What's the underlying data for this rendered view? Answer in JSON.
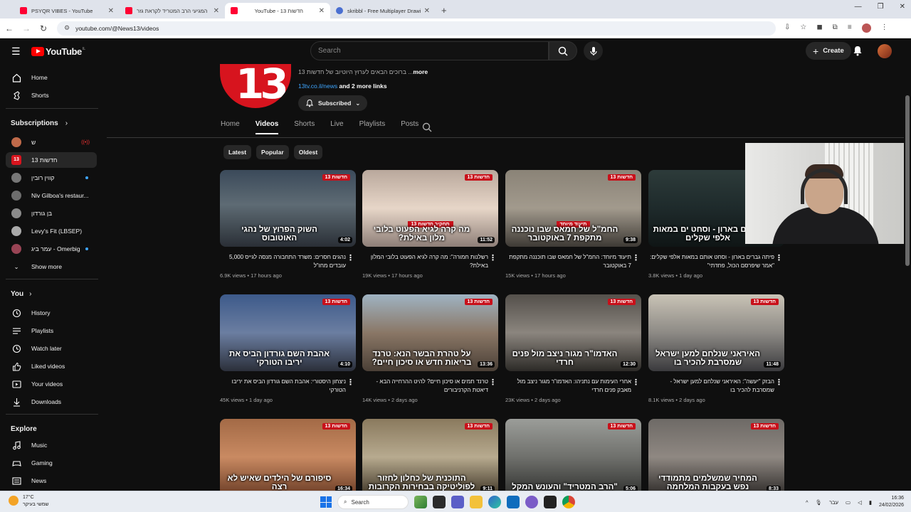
{
  "browser": {
    "tabs": [
      {
        "title": "PSYQR VIBES - YouTube",
        "icon": "youtube"
      },
      {
        "title": "המגיעי הרב המטריד לקראת גזר",
        "icon": "youtube"
      },
      {
        "title": "YouTube - חדשות 13",
        "icon": "youtube"
      },
      {
        "title": "skribbl - Free Multiplayer Drawi",
        "icon": "skribbl"
      }
    ],
    "url": "youtube.com/@News13/videos"
  },
  "yt": {
    "logo": "YouTube",
    "logo_cc": "IL",
    "search_placeholder": "Search",
    "create_label": "Create"
  },
  "sidebar": {
    "main": [
      {
        "label": "Home",
        "icon": "home-icon"
      },
      {
        "label": "Shorts",
        "icon": "shorts-icon"
      }
    ],
    "subscriptions_title": "Subscriptions",
    "subscriptions": [
      {
        "label": "ש",
        "color": "#c06a4a"
      },
      {
        "label": "חדשות 13",
        "color": "#d7141e"
      },
      {
        "label": "קווין רובין",
        "color": "#777"
      },
      {
        "label": "Niv Gilboa's restaur...",
        "color": "#6d6d6d"
      },
      {
        "label": "בן גורדון",
        "color": "#8a8a8a"
      },
      {
        "label": "Levy's Fit (LBSEP)",
        "color": "#aaa"
      },
      {
        "label": "עמר ביג - Omerbig",
        "color": "#945"
      }
    ],
    "show_more": "Show more",
    "you_title": "You",
    "you": [
      {
        "label": "History",
        "icon": "history-icon"
      },
      {
        "label": "Playlists",
        "icon": "playlists-icon"
      },
      {
        "label": "Watch later",
        "icon": "watch-later-icon"
      },
      {
        "label": "Liked videos",
        "icon": "liked-icon"
      },
      {
        "label": "Your videos",
        "icon": "your-videos-icon"
      },
      {
        "label": "Downloads",
        "icon": "downloads-icon"
      }
    ],
    "explore_title": "Explore",
    "explore": [
      {
        "label": "Music",
        "icon": "music-icon"
      },
      {
        "label": "Gaming",
        "icon": "gaming-icon"
      },
      {
        "label": "News",
        "icon": "news-icon"
      }
    ]
  },
  "channel": {
    "logo_text": "13",
    "description": "ברוכים הבאים לערוץ היוטיוב של חדשות 13 ...",
    "more": "more",
    "link": "13tv.co.il/news",
    "more_links": "and 2 more links",
    "subscribed": "Subscribed",
    "tabs": [
      "Home",
      "Videos",
      "Shorts",
      "Live",
      "Playlists",
      "Posts"
    ],
    "active_tab": "Videos",
    "chips": [
      "Latest",
      "Popular",
      "Oldest"
    ]
  },
  "videos": [
    {
      "headline": "השוק הפרוץ של נהגי האוטובוס",
      "duration": "4:02",
      "title": "נהגים חסרים: משרד התחבורה מנסה לגייס 5,000 עובדים מחו\"ל",
      "views": "6.9K views",
      "age": "17 hours ago",
      "tag": "",
      "bg": "linear-gradient(180deg,#3b4a5a,#5e6b74 45%,#2a2f36)"
    },
    {
      "headline": "מה קרה לגיא הפעוט בלובי מלון באילת?",
      "duration": "11:52",
      "title": "רשלנות חמורה\": מה קרה לגיא הפעוט בלובי המלון באילת?",
      "views": "19K views",
      "age": "17 hours ago",
      "tag": "תחקיר חדשות 13",
      "bg": "linear-gradient(180deg,#b9a89c,#e7d6c8 50%,#8e7f78)"
    },
    {
      "headline": "החמ\"ל של חמאס שבו נוכננה מתקפת 7 באוקטובר",
      "duration": "9:38",
      "title": "תיעוד מיוחד: החמ\"ל של חמאס שבו תוכננה מתקפת 7 באוקטובר",
      "views": "15K views",
      "age": "17 hours ago",
      "tag": "תיעוד מיוחד",
      "bg": "linear-gradient(180deg,#8a8377,#a29a8d 50%,#3e3a35)"
    },
    {
      "headline": "גברים בארון - וסחט ים במאות אלפי שקלים",
      "duration": "",
      "title": "פיתה גברים בארון - וסחט אותם במאות אלפי שקלים: \"אמר שיפרסם הכול, פחדתי\"",
      "views": "3.8K views",
      "age": "1 day ago",
      "tag": "",
      "bg": "linear-gradient(180deg,#2d3b3a,#1e2a2b 50%,#0f1515)"
    },
    {
      "headline": "אהבת השם גורדון הביס את יריבו הטורקי",
      "duration": "4:10",
      "title": "ניצחון היסטורי: אהבת השם גורדון הביס את יריבו הטורקי",
      "views": "45K views",
      "age": "1 day ago",
      "tag": "",
      "bg": "linear-gradient(180deg,#3d5a8a,#6b7ea1 50%,#2b2f3a)"
    },
    {
      "headline": "על טהרת הבשר הנא: טרנד בריאות חדש או סיכון חיים?",
      "duration": "13:36",
      "title": "טרנד תמים או סיכון חיים? להיט ההרחייה הבא - דיאטת הקרניבורים",
      "views": "14K views",
      "age": "2 days ago",
      "tag": "",
      "bg": "linear-gradient(180deg,#9fb3c2,#8a7766 50%,#4a3f36)"
    },
    {
      "headline": "האדמו\"ר מגור ניצב מול פנים חרדי",
      "duration": "12:30",
      "title": "אחרי העימות עם נתניהו: האדמו\"ר מגור ניצב מול מאבק פנים חרדי",
      "views": "23K views",
      "age": "2 days ago",
      "tag": "",
      "bg": "linear-gradient(180deg,#54504b,#8b857e 50%,#2c2a27)"
    },
    {
      "headline": "האיראני שנלחם למען ישראל שמסרבת להכיר בו",
      "duration": "11:48",
      "title": "הבזק \"יעשה\": האיראני שנלחם למען ישראל - שמסרבת להכיר בו",
      "views": "8.1K views",
      "age": "2 days ago",
      "tag": "",
      "bg": "linear-gradient(180deg,#c9c3b6,#8d8a85 50%,#3a3a3d)"
    },
    {
      "headline": "סיפורם של הילדים שאיש לא רצה",
      "duration": "16:34",
      "title": "",
      "views": "",
      "age": "",
      "tag": "",
      "bg": "linear-gradient(180deg,#a36a46,#c98a62 50%,#6b3d26)"
    },
    {
      "headline": "התוכנית של כחלון לחזור לפוליטיקה בבחירות הקרובות",
      "duration": "9:11",
      "title": "",
      "views": "",
      "age": "",
      "tag": "",
      "bg": "linear-gradient(180deg,#8a7a5e,#b7aa8f 50%,#3e3526)"
    },
    {
      "headline": "\"הרב המטריד\" והעונש המקל",
      "duration": "5:06",
      "title": "",
      "views": "",
      "age": "",
      "tag": "",
      "bg": "linear-gradient(180deg,#9b9d99,#6f706c 50%,#2f302e)"
    },
    {
      "headline": "המחיר שמשלמים מתמודדי נפש בעקבות המלחמה",
      "duration": "8:33",
      "title": "",
      "views": "",
      "age": "",
      "tag": "",
      "bg": "linear-gradient(180deg,#6e6a66,#8f8882 50%,#2d2a28)"
    }
  ],
  "red_badge": "חדשות 13",
  "taskbar": {
    "temp": "17°C",
    "weather": "שמשי בעיקר",
    "search": "Search",
    "lang": "עבר",
    "time": "16:36",
    "date": "24/02/2026"
  }
}
